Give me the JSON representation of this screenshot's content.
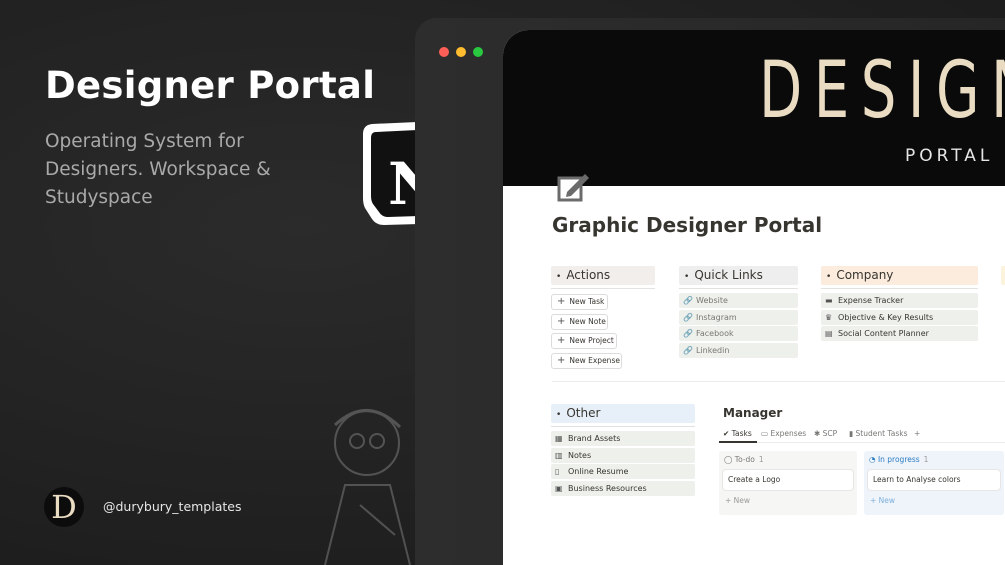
{
  "hero": {
    "title": "Designer Portal",
    "subtitle": "Operating System for Designers. Workspace & Studyspace"
  },
  "brand": {
    "logo_icon": "notion-logo",
    "logo_letter": "N",
    "avatar_letter": "D",
    "handle": "@durybury_templates"
  },
  "colors": {
    "background": "#242424",
    "cover_text": "#e9dcc2",
    "accent_blue": "#2b7bc2"
  },
  "window": {
    "cover_title": "DESIGN",
    "cover_subtitle": "PORTAL",
    "page_title": "Graphic Designer Portal",
    "page_icon": "edit-square-icon"
  },
  "sections": {
    "actions": {
      "label": "Actions",
      "buttons": [
        "New Task",
        "New Note",
        "New Project",
        "New Expense"
      ]
    },
    "quick_links": {
      "label": "Quick Links",
      "links": [
        "Website",
        "Instagram",
        "Facebook",
        "Linkedin"
      ]
    },
    "company": {
      "label": "Company",
      "items": [
        "Expense Tracker",
        "Objective & Key Results",
        "Social Content Planner"
      ]
    },
    "other": {
      "label": "Other",
      "items": [
        "Brand Assets",
        "Notes",
        "Online Resume",
        "Business Resources"
      ]
    }
  },
  "manager": {
    "title": "Manager",
    "tabs": [
      "Tasks",
      "Expenses",
      "SCP",
      "Student Tasks"
    ],
    "add_tab": "+",
    "columns": [
      {
        "status": "To-do",
        "count": "1",
        "card": "Create a Logo",
        "new_label": "New"
      },
      {
        "status": "In progress",
        "count": "1",
        "card": "Learn to Analyse colors",
        "new_label": "New"
      }
    ]
  }
}
